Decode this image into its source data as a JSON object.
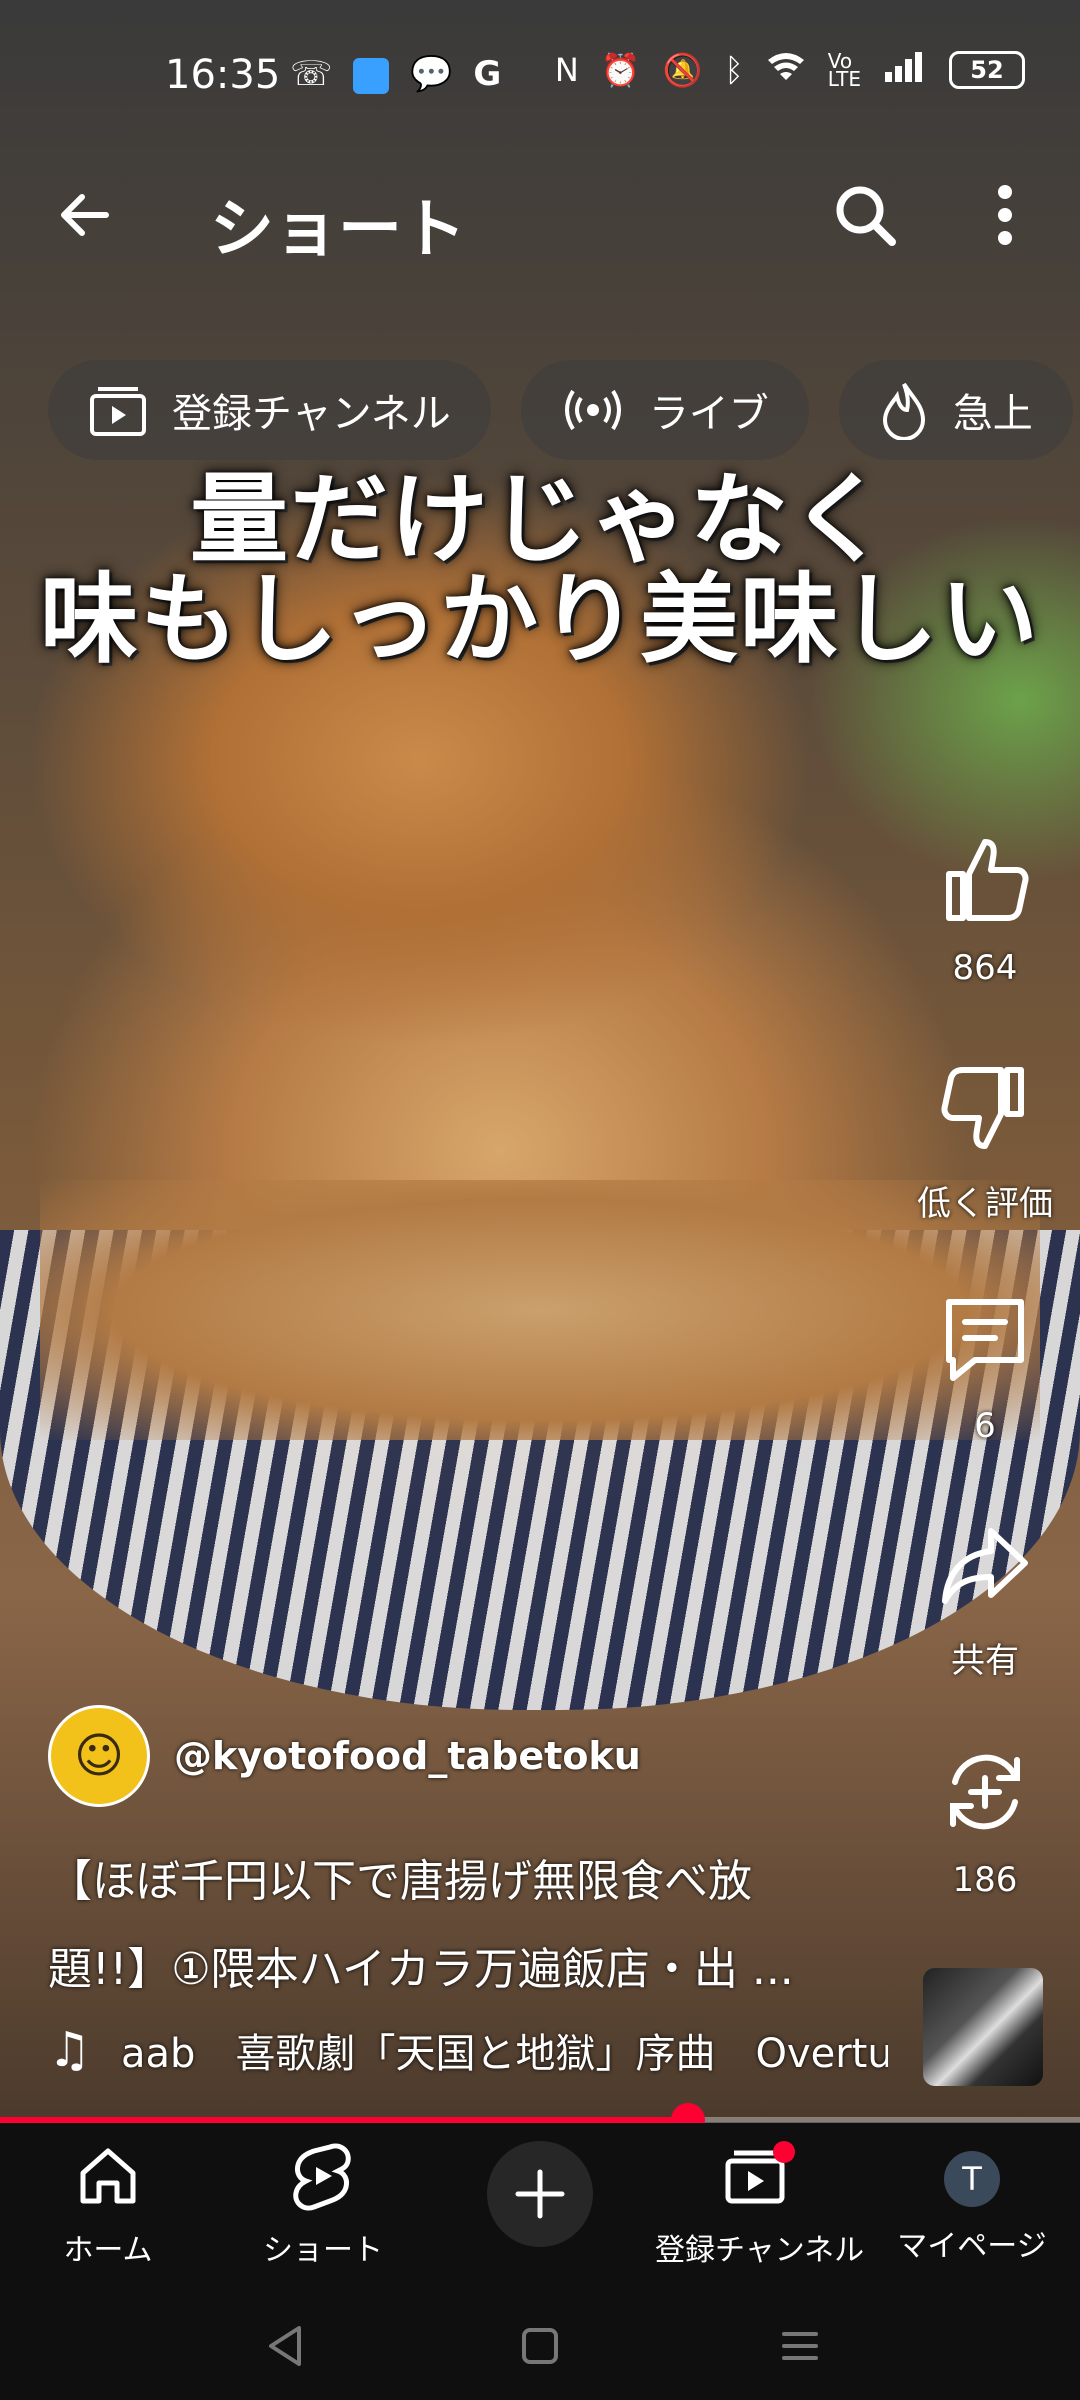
{
  "status_bar": {
    "time": "16:35",
    "battery": "52",
    "left_icons": [
      "missed-call-icon",
      "app-badge-icon",
      "line-icon",
      "google-icon"
    ],
    "right_icons": [
      "nfc-icon",
      "alarm-icon",
      "mute-icon",
      "bluetooth-icon",
      "wifi-icon",
      "volte-icon",
      "signal-icon"
    ]
  },
  "top_bar": {
    "title": "ショート"
  },
  "chips": [
    {
      "label": "登録チャンネル",
      "icon": "subscriptions-icon"
    },
    {
      "label": "ライブ",
      "icon": "live-icon"
    },
    {
      "label": "急上",
      "icon": "trending-icon"
    }
  ],
  "video": {
    "caption_line1": "量だけじゃなく",
    "caption_line2": "味もしっかり美味しい"
  },
  "actions": {
    "like_count": "864",
    "dislike_label": "低く評価",
    "comment_count": "6",
    "share_label": "共有",
    "remix_count": "186"
  },
  "channel": {
    "handle": "@kyotofood_tabetoku"
  },
  "description": {
    "line1": "【ほぼ千円以下で唐揚げ無限食べ放",
    "line2": "題!!】①隈本ハイカラ万遍飯店・出 ..."
  },
  "music": {
    "text": "aab　喜歌劇「天国と地獄」序曲　Overtu"
  },
  "progress": {
    "fraction": 0.637
  },
  "bottom_nav": {
    "home": "ホーム",
    "shorts": "ショート",
    "subscriptions": "登録チャンネル",
    "mypage": "マイページ",
    "avatar_initial": "T"
  },
  "colors": {
    "accent": "#ff0033",
    "background": "#0f0f0f"
  }
}
